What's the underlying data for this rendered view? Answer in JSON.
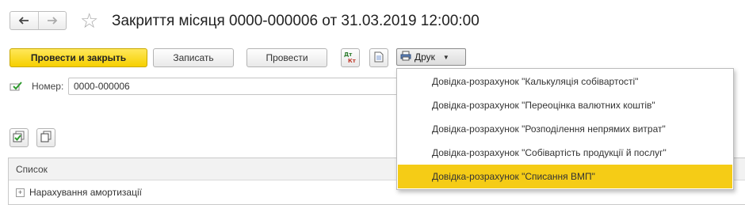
{
  "header": {
    "back_glyph": "🡐",
    "forward_glyph": "🡒",
    "title": "Закриття місяця 0000-000006 от 31.03.2019 12:00:00"
  },
  "toolbar": {
    "post_and_close_label": "Провести и закрыть",
    "write_label": "Записать",
    "post_label": "Провести",
    "print_label": "Друк"
  },
  "form": {
    "number_label": "Номер:",
    "number_value": "0000-000006"
  },
  "table": {
    "header": "Список",
    "rows": [
      "Нарахування амортизації"
    ]
  },
  "print_menu": {
    "items": [
      "Довідка-розрахунок \"Калькуляція собівартості\"",
      "Довідка-розрахунок \"Переоцінка валютних коштів\"",
      "Довідка-розрахунок \"Розподілення непрямих витрат\"",
      "Довідка-розрахунок \"Собівартість продукції й послуг\"",
      "Довідка-розрахунок \"Списання ВМП\""
    ],
    "selected_index": 4
  },
  "colors": {
    "primary_button": "#f6cf00",
    "menu_highlight": "#f5cc16"
  },
  "icons": [
    "arrow-left-icon",
    "arrow-right-icon",
    "star-icon",
    "dt-kt-icon",
    "document-icon",
    "printer-icon",
    "dropdown-arrow-icon",
    "check-document-icon",
    "check-all-icon",
    "copy-icon",
    "expand-plus-icon"
  ]
}
